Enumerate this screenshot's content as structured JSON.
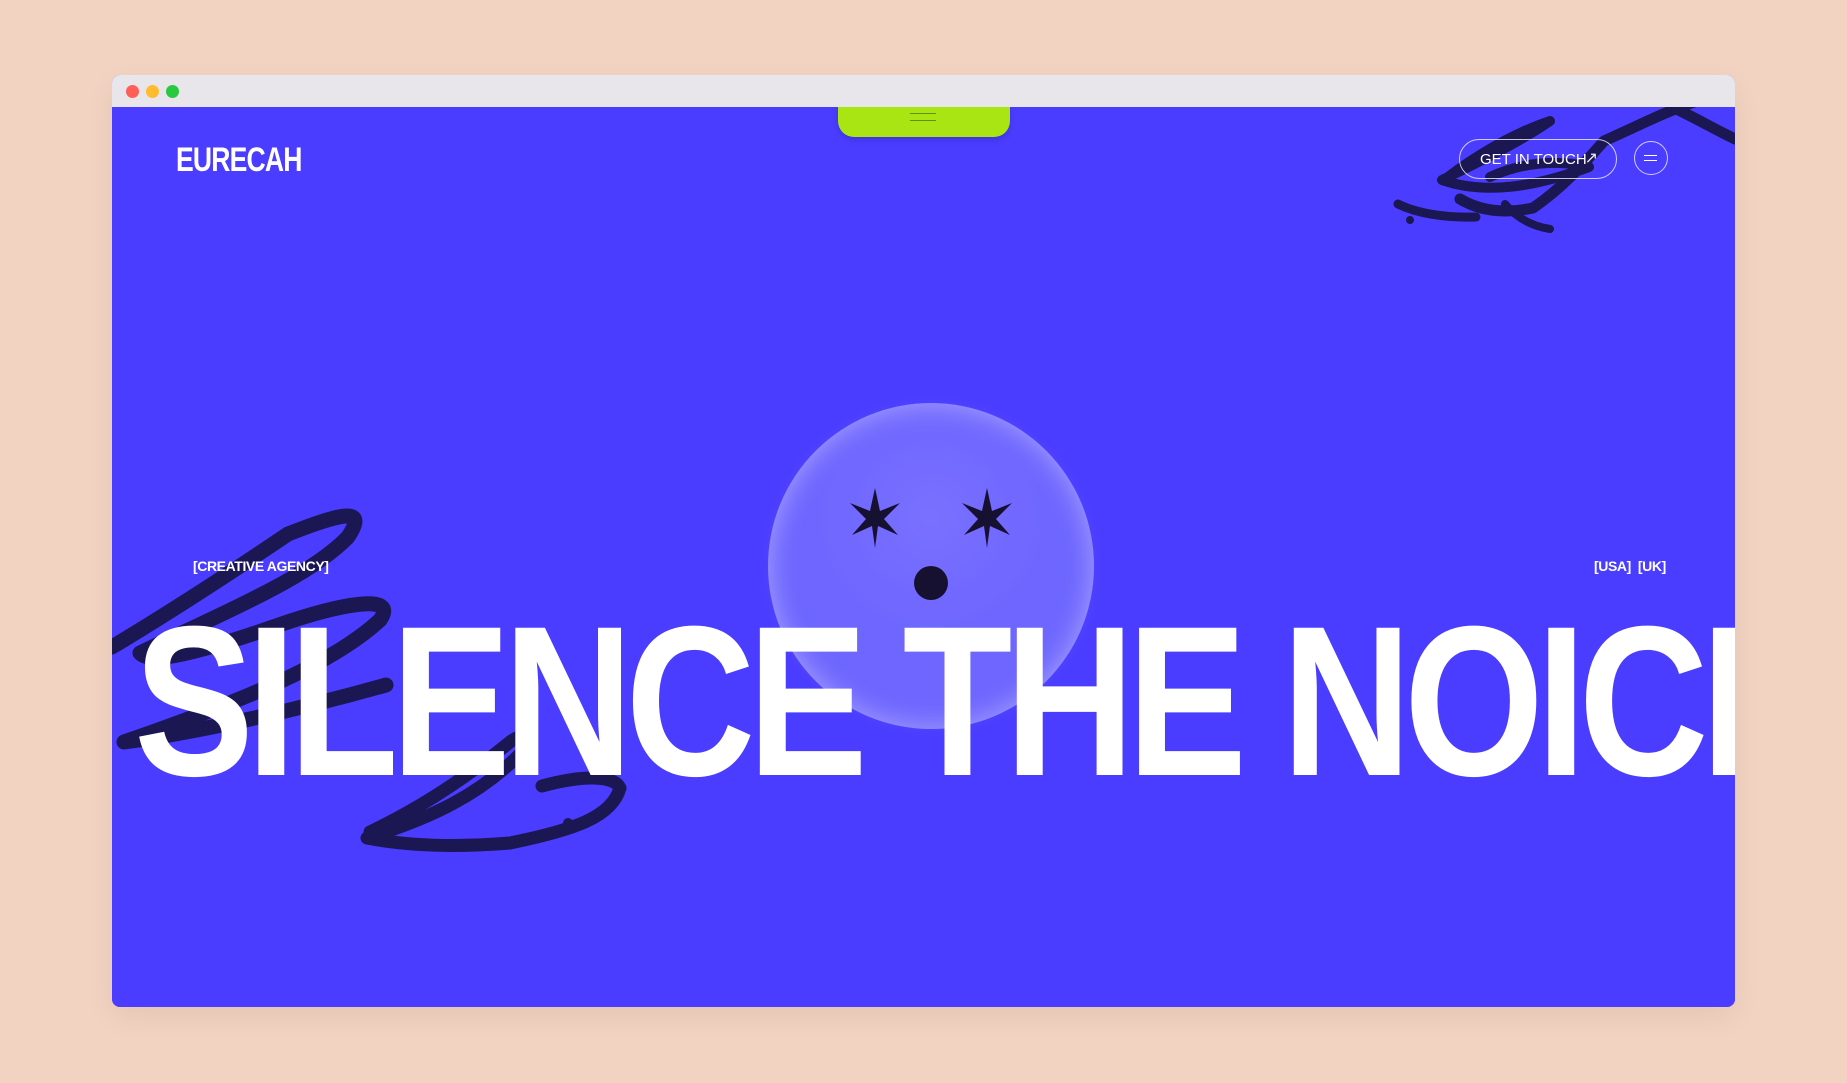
{
  "window": {
    "traffic_lights": [
      "red",
      "yellow",
      "green"
    ]
  },
  "nav": {
    "logo": "EURECAH",
    "cta_label": "GET IN TOUCH",
    "cta_icon": "arrow-up-right-icon",
    "menu_icon": "menu-icon"
  },
  "tab": {
    "icon": "menu-lines-icon"
  },
  "hero": {
    "tag": "[CREATIVE AGENCY]",
    "regions": [
      "[USA]",
      "[UK]"
    ],
    "headline": "SILENCE THE NOICE"
  },
  "colors": {
    "page_bg": "#f2d2c0",
    "hero_bg": "#4a3dff",
    "accent": "#a8e513",
    "scribble": "#1b1753",
    "text": "#ffffff"
  }
}
